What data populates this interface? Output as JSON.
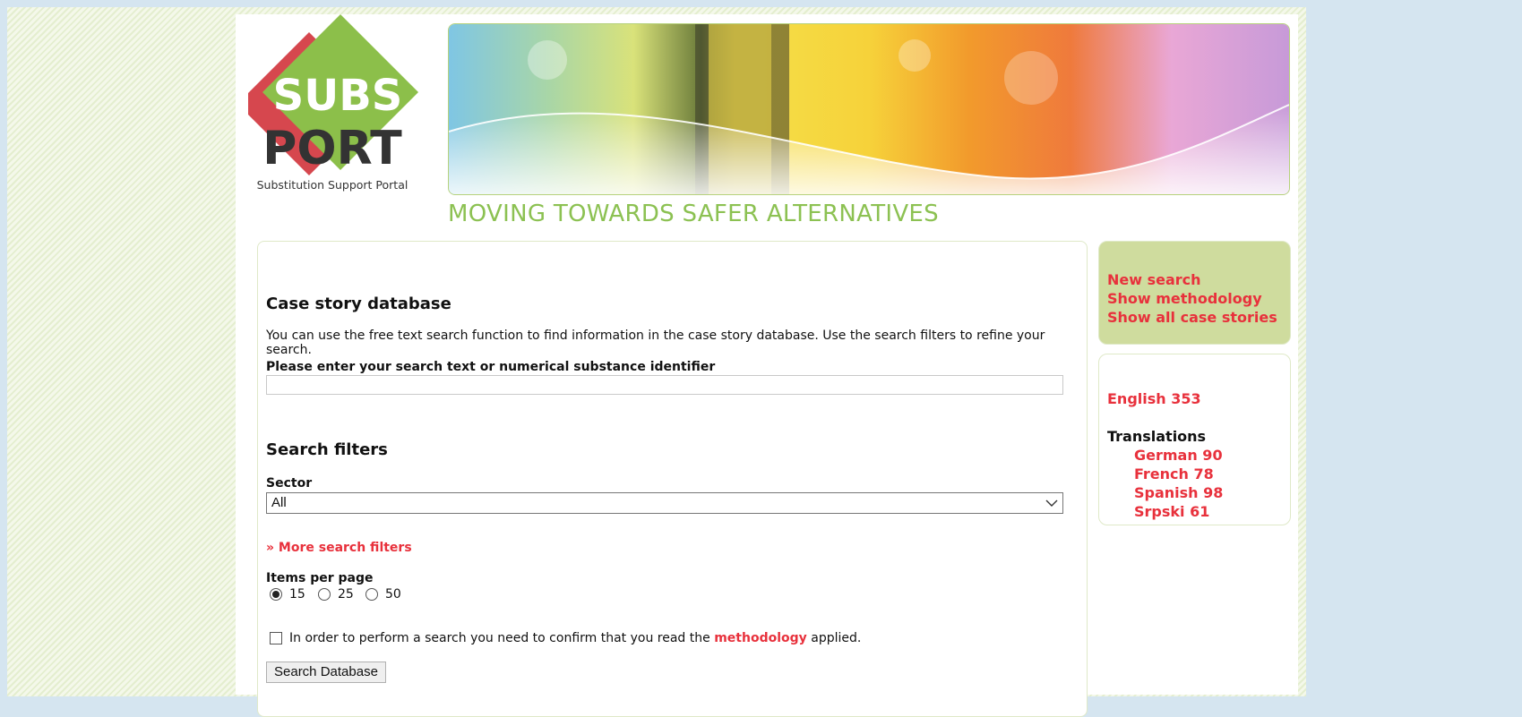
{
  "branding": {
    "logo_top": "SUBS",
    "logo_bottom": "PORT",
    "logo_sub": "Substitution Support Portal",
    "tagline": "MOVING TOWARDS SAFER ALTERNATIVES"
  },
  "main": {
    "title": "Case story database",
    "intro": "You can use the free text search function to find information in the case story database. Use the search filters to refine your search.",
    "search_label": "Please enter your search text or numerical substance identifier",
    "search_value": "",
    "filters_title": "Search filters",
    "sector_label": "Sector",
    "sector_value": "All",
    "more_filters": "» More search filters",
    "items_label": "Items per page",
    "items_options": [
      "15",
      "25",
      "50"
    ],
    "items_selected": "15",
    "confirm_text_before": "In order to perform a search you need to confirm that you read the",
    "confirm_link": "methodology",
    "confirm_text_after": "applied.",
    "search_button": "Search Database"
  },
  "sidebar": {
    "links": [
      "New search",
      "Show methodology",
      "Show all case stories"
    ],
    "english": "English 353",
    "translations_title": "Translations",
    "translations": [
      "German 90",
      "French 78",
      "Spanish 98",
      "Srpski 61"
    ]
  },
  "colors": {
    "accent_red": "#e8313c",
    "brand_green": "#8cc152",
    "sidebar_green": "#cfdc9e"
  }
}
